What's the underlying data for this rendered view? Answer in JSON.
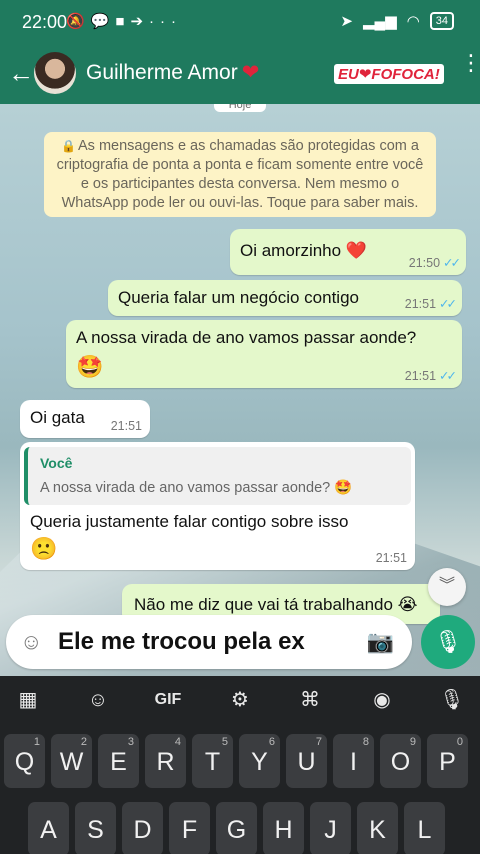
{
  "status_bar": {
    "time": "22:00",
    "battery": "34"
  },
  "header": {
    "contact_name": "Guilherme Amor",
    "contact_emoji": "❤",
    "overlay_logo": "EU❤FOFOCA!"
  },
  "chat": {
    "date_chip": "Hoje",
    "encryption_notice": "As mensagens e as chamadas são protegidas com a criptografia de ponta a ponta e ficam somente entre você e os participantes desta conversa. Nem mesmo o WhatsApp pode ler ou ouvi-las. Toque para saber mais.",
    "messages": [
      {
        "text": "Oi amorzinho ❤️",
        "time": "21:50",
        "direction": "out"
      },
      {
        "text": "Queria falar um negócio contigo",
        "time": "21:51",
        "direction": "out"
      },
      {
        "text": "A nossa virada de ano vamos passar aonde?",
        "emoji": "🤩",
        "time": "21:51",
        "direction": "out"
      },
      {
        "text": "Oi gata",
        "time": "21:51",
        "direction": "in"
      },
      {
        "quote_author": "Você",
        "quote_text": "A nossa virada de ano vamos passar aonde? 🤩",
        "text": "Queria justamente falar contigo sobre isso",
        "emoji": "🙁",
        "time": "21:51",
        "direction": "in"
      },
      {
        "text": "Não me diz que vai tá trabalhando 😭",
        "direction": "out"
      }
    ]
  },
  "composer": {
    "overlay_caption": "Ele me trocou pela ex"
  },
  "keyboard": {
    "tools": {
      "gif_label": "GIF"
    },
    "row1": [
      {
        "key": "Q",
        "num": "1"
      },
      {
        "key": "W",
        "num": "2"
      },
      {
        "key": "E",
        "num": "3"
      },
      {
        "key": "R",
        "num": "4"
      },
      {
        "key": "T",
        "num": "5"
      },
      {
        "key": "Y",
        "num": "6"
      },
      {
        "key": "U",
        "num": "7"
      },
      {
        "key": "I",
        "num": "8"
      },
      {
        "key": "O",
        "num": "9"
      },
      {
        "key": "P",
        "num": "0"
      }
    ],
    "row2": [
      "A",
      "S",
      "D",
      "F",
      "G",
      "H",
      "J",
      "K",
      "L"
    ]
  },
  "colors": {
    "header_green": "#1f7a5e",
    "outgoing_bubble": "#e4f8cb",
    "read_ticks": "#4fb6ec",
    "mic_button": "#1faa7d"
  }
}
